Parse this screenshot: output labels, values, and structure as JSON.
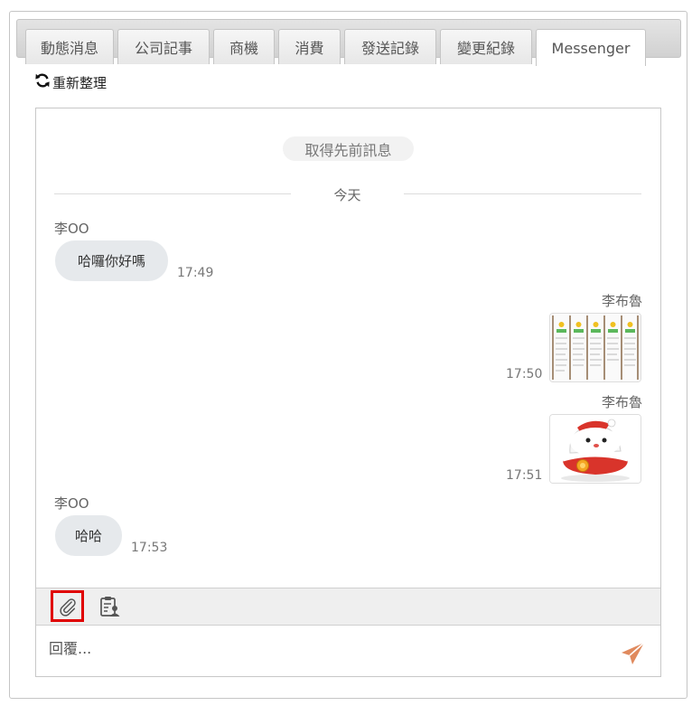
{
  "tabs": [
    {
      "label": "動態消息",
      "active": false
    },
    {
      "label": "公司記事",
      "active": false
    },
    {
      "label": "商機",
      "active": false
    },
    {
      "label": "消費",
      "active": false
    },
    {
      "label": "發送記錄",
      "active": false
    },
    {
      "label": "變更紀錄",
      "active": false
    },
    {
      "label": "Messenger",
      "active": true
    }
  ],
  "refresh_label": "重新整理",
  "chat": {
    "load_previous": "取得先前訊息",
    "day_label": "今天",
    "messages": [
      {
        "sender": "李OO",
        "text": "哈囉你好嗎",
        "time": "17:49",
        "side": "left"
      },
      {
        "sender": "李布魯",
        "image": "table-screenshot-thumbnail",
        "time": "17:50",
        "side": "right"
      },
      {
        "sender": "李布魯",
        "image": "cartoon-sticker",
        "time": "17:51",
        "side": "right"
      },
      {
        "sender": "李OO",
        "text": "哈哈",
        "time": "17:53",
        "side": "left"
      }
    ]
  },
  "toolbar": {
    "attach_icon": "paperclip-icon",
    "template_icon": "clipboard-user-icon"
  },
  "reply": {
    "placeholder": "回覆..."
  },
  "colors": {
    "send_icon": "#e08a5e",
    "highlight_border": "#e00000",
    "bubble_bg": "#e6e9ec"
  }
}
